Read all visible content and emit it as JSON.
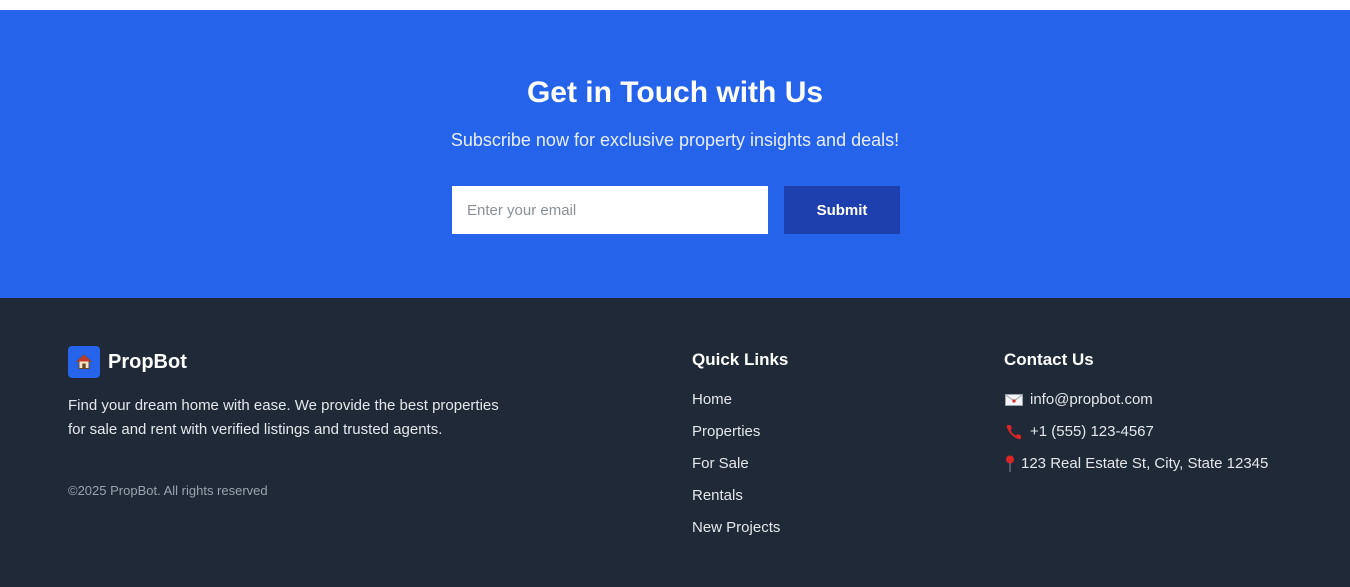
{
  "newsletter": {
    "title": "Get in Touch with Us",
    "subtitle": "Subscribe now for exclusive property insights and deals!",
    "email_placeholder": "Enter your email",
    "submit_label": "Submit",
    "background_color": "#2563eb",
    "button_color": "#1e40af"
  },
  "footer": {
    "background_color": "#1f2937",
    "brand": {
      "icon": "house-icon",
      "name": "PropBot",
      "description": "Find your dream home with ease. We provide the best properties for sale and rent with verified listings and trusted agents.",
      "copyright": "©2025 PropBot. All rights reserved"
    },
    "quick_links": {
      "title": "Quick Links",
      "items": [
        {
          "label": "Home"
        },
        {
          "label": "Properties"
        },
        {
          "label": "For Sale"
        },
        {
          "label": "Rentals"
        },
        {
          "label": "New Projects"
        }
      ]
    },
    "contact": {
      "title": "Contact Us",
      "items": [
        {
          "icon": "envelope-icon",
          "text": "info@propbot.com"
        },
        {
          "icon": "phone-icon",
          "text": "+1 (555) 123-4567"
        },
        {
          "icon": "location-pin-icon",
          "text": "123 Real Estate St, City, State 12345"
        }
      ]
    }
  }
}
